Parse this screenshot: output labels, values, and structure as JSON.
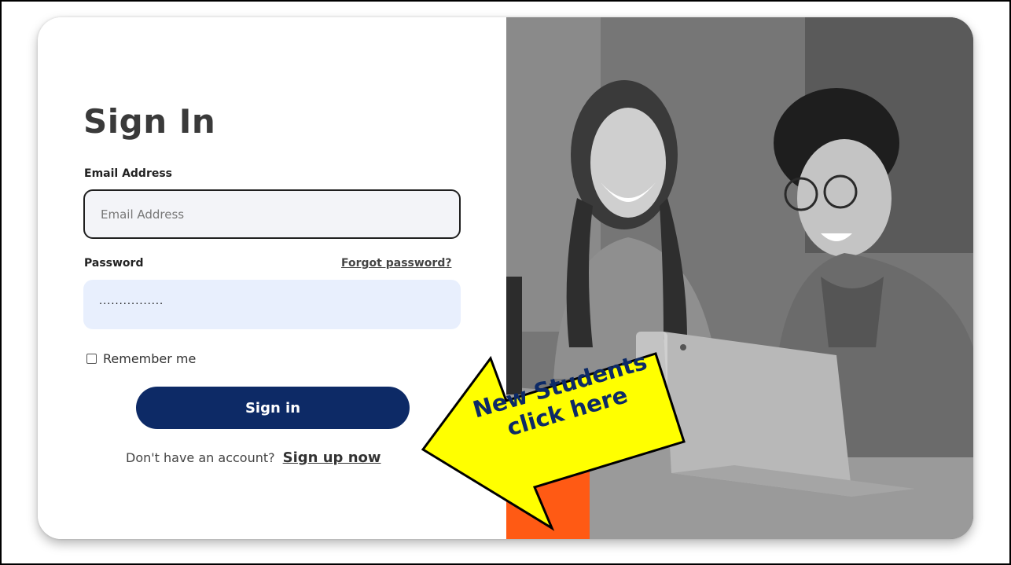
{
  "form": {
    "heading": "Sign In",
    "email_label": "Email Address",
    "email_placeholder": "Email Address",
    "email_value": "",
    "password_label": "Password",
    "forgot_password": "Forgot password?",
    "password_value": "················",
    "remember_me": "Remember me",
    "remember_checked": false,
    "signin_button": "Sign in",
    "no_account_prompt": "Don't have an account?",
    "signup_link": "Sign up now"
  },
  "callout": {
    "line1": "New Students",
    "line2": "click here",
    "fill_color": "#ffff00"
  },
  "colors": {
    "primary_button": "#0d2a66",
    "brand_tile": "#ff5a14"
  },
  "icons": {
    "brand_tile_icon": "texas-state-icon",
    "callout": "arrow-callout-icon"
  }
}
